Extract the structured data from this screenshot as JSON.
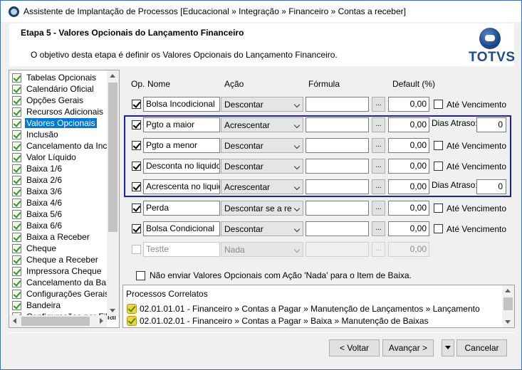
{
  "window": {
    "title": "Assistente de Implantação de Processos [Educacional » Integração » Financeiro » Contas a receber]"
  },
  "header": {
    "step_title": "Etapa 5 - Valores Opcionais do Lançamento Financeiro",
    "description": "O objetivo desta etapa é definir os Valores Opcionais do Lançamento Financeiro.",
    "logo_text": "TOTVS"
  },
  "tree": {
    "items": [
      {
        "label": "Tabelas Opcionais"
      },
      {
        "label": "Calendário Oficial"
      },
      {
        "label": "Opções Gerais"
      },
      {
        "label": "Recursos Adicionais"
      },
      {
        "label": "Valores Opcionais"
      },
      {
        "label": "Inclusão"
      },
      {
        "label": "Cancelamento da Inclusã"
      },
      {
        "label": "Valor Líquido"
      },
      {
        "label": "Baixa 1/6"
      },
      {
        "label": "Baixa 2/6"
      },
      {
        "label": "Baixa 3/6"
      },
      {
        "label": "Baixa 4/6"
      },
      {
        "label": "Baixa 5/6"
      },
      {
        "label": "Baixa 6/6"
      },
      {
        "label": "Baixa a Receber"
      },
      {
        "label": "Cheque"
      },
      {
        "label": "Cheque a Receber"
      },
      {
        "label": "Impressora Cheque"
      },
      {
        "label": "Cancelamento da Baixa"
      },
      {
        "label": "Configurações Gerais"
      },
      {
        "label": "Bandeira"
      },
      {
        "label": "Configurações por Filial"
      }
    ],
    "selected_index": 4
  },
  "grid": {
    "headers": {
      "op": "Op.",
      "name": "Nome",
      "action": "Ação",
      "formula": "Fórmula",
      "default": "Default (%)"
    },
    "rows": [
      {
        "checked": true,
        "name": "Bolsa Incodicional",
        "action": "Descontar",
        "formula": "",
        "default": "0,00",
        "extra": "ate",
        "extra_label": "Até Vencimento",
        "disabled": false
      },
      {
        "checked": true,
        "name": "Pgto a maior",
        "action": "Acrescentar",
        "formula": "",
        "default": "0,00",
        "extra": "dias",
        "extra_label": "Dias Atraso:",
        "dias_value": "0",
        "disabled": false
      },
      {
        "checked": true,
        "name": "Pgto a menor",
        "action": "Descontar",
        "formula": "",
        "default": "0,00",
        "extra": "ate",
        "extra_label": "Até Vencimento",
        "disabled": false
      },
      {
        "checked": true,
        "name": "Desconta no liquido",
        "action": "Descontar",
        "formula": "",
        "default": "0,00",
        "extra": "ate",
        "extra_label": "Até Vencimento",
        "disabled": false
      },
      {
        "checked": true,
        "name": "Acrescenta no liquido",
        "action": "Acrescentar",
        "formula": "",
        "default": "0,00",
        "extra": "dias",
        "extra_label": "Dias Atraso:",
        "dias_value": "0",
        "disabled": false
      },
      {
        "checked": true,
        "name": "Perda",
        "action": "Descontar se a rece",
        "formula": "",
        "default": "0,00",
        "extra": "ate",
        "extra_label": "Até Vencimento",
        "disabled": false
      },
      {
        "checked": true,
        "name": "Bolsa Condicional",
        "action": "Descontar",
        "formula": "",
        "default": "0,00",
        "extra": "ate",
        "extra_label": "Até Vencimento",
        "disabled": false
      },
      {
        "checked": false,
        "name": "Testte",
        "action": "Nada",
        "formula": "",
        "default": "0,00",
        "extra": "none",
        "disabled": true
      }
    ],
    "dots_label": "..."
  },
  "options": {
    "skip_nada_label": "Não enviar Valores Opcionais com Ação 'Nada' para o Item de Baixa.",
    "skip_nada_checked": false
  },
  "related": {
    "title": "Processos Correlatos",
    "items": [
      {
        "label": "02.01.01.01 - Financeiro » Contas a Pagar » Manutenção de Lançamentos » Lançamento"
      },
      {
        "label": "02.01.02.01 - Financeiro » Contas a Pagar » Baixa » Manutenção de Baixas"
      }
    ]
  },
  "buttons": {
    "back": "< Voltar",
    "next": "Avançar >",
    "cancel": "Cancelar"
  },
  "colors": {
    "highlight_border": "#1c21b2",
    "selection": "#0078d7",
    "logo": "#1d4b8d"
  }
}
